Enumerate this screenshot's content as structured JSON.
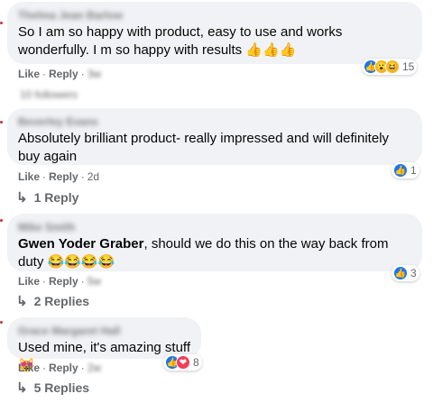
{
  "comments": [
    {
      "author": "Thelma Jean Barlow",
      "text": "So I am so happy with product, easy to use and works wonderfully. I m so happy with results 👍👍👍",
      "like_label": "Like",
      "reply_label": "Reply",
      "time": "3w",
      "reactions": {
        "icons": [
          "like-icon",
          "wow-icon",
          "haha-icon"
        ],
        "count": "15"
      },
      "extra_line": "10 followers"
    },
    {
      "author": "Beverley Evans",
      "text": "Absolutely brilliant product- really impressed and will definitely buy again",
      "like_label": "Like",
      "reply_label": "Reply",
      "time": "2d",
      "reactions": {
        "icons": [
          "like-icon"
        ],
        "count": "1"
      },
      "replies_label": "1 Reply"
    },
    {
      "author": "Mike Smith",
      "mention": "Gwen Yoder Graber",
      "text": ", should we do this on the way back from duty 😂😂😂😂",
      "like_label": "Like",
      "reply_label": "Reply",
      "time": "5w",
      "reactions": {
        "icons": [
          "like-icon"
        ],
        "count": "3"
      },
      "replies_label": "2 Replies"
    },
    {
      "author": "Grace Margaret Hall",
      "text": "Used mine, it's amazing stuff 😻",
      "like_label": "Like",
      "reply_label": "Reply",
      "time": "2w",
      "reactions": {
        "icons": [
          "like-icon",
          "love-icon"
        ],
        "count": "8"
      },
      "replies_label": "5 Replies"
    }
  ],
  "colors": {
    "bubble": "#f0f2f5",
    "meta": "#65676b",
    "like": "#1877f2",
    "love": "#f33e58",
    "haha": "#f7b125"
  }
}
